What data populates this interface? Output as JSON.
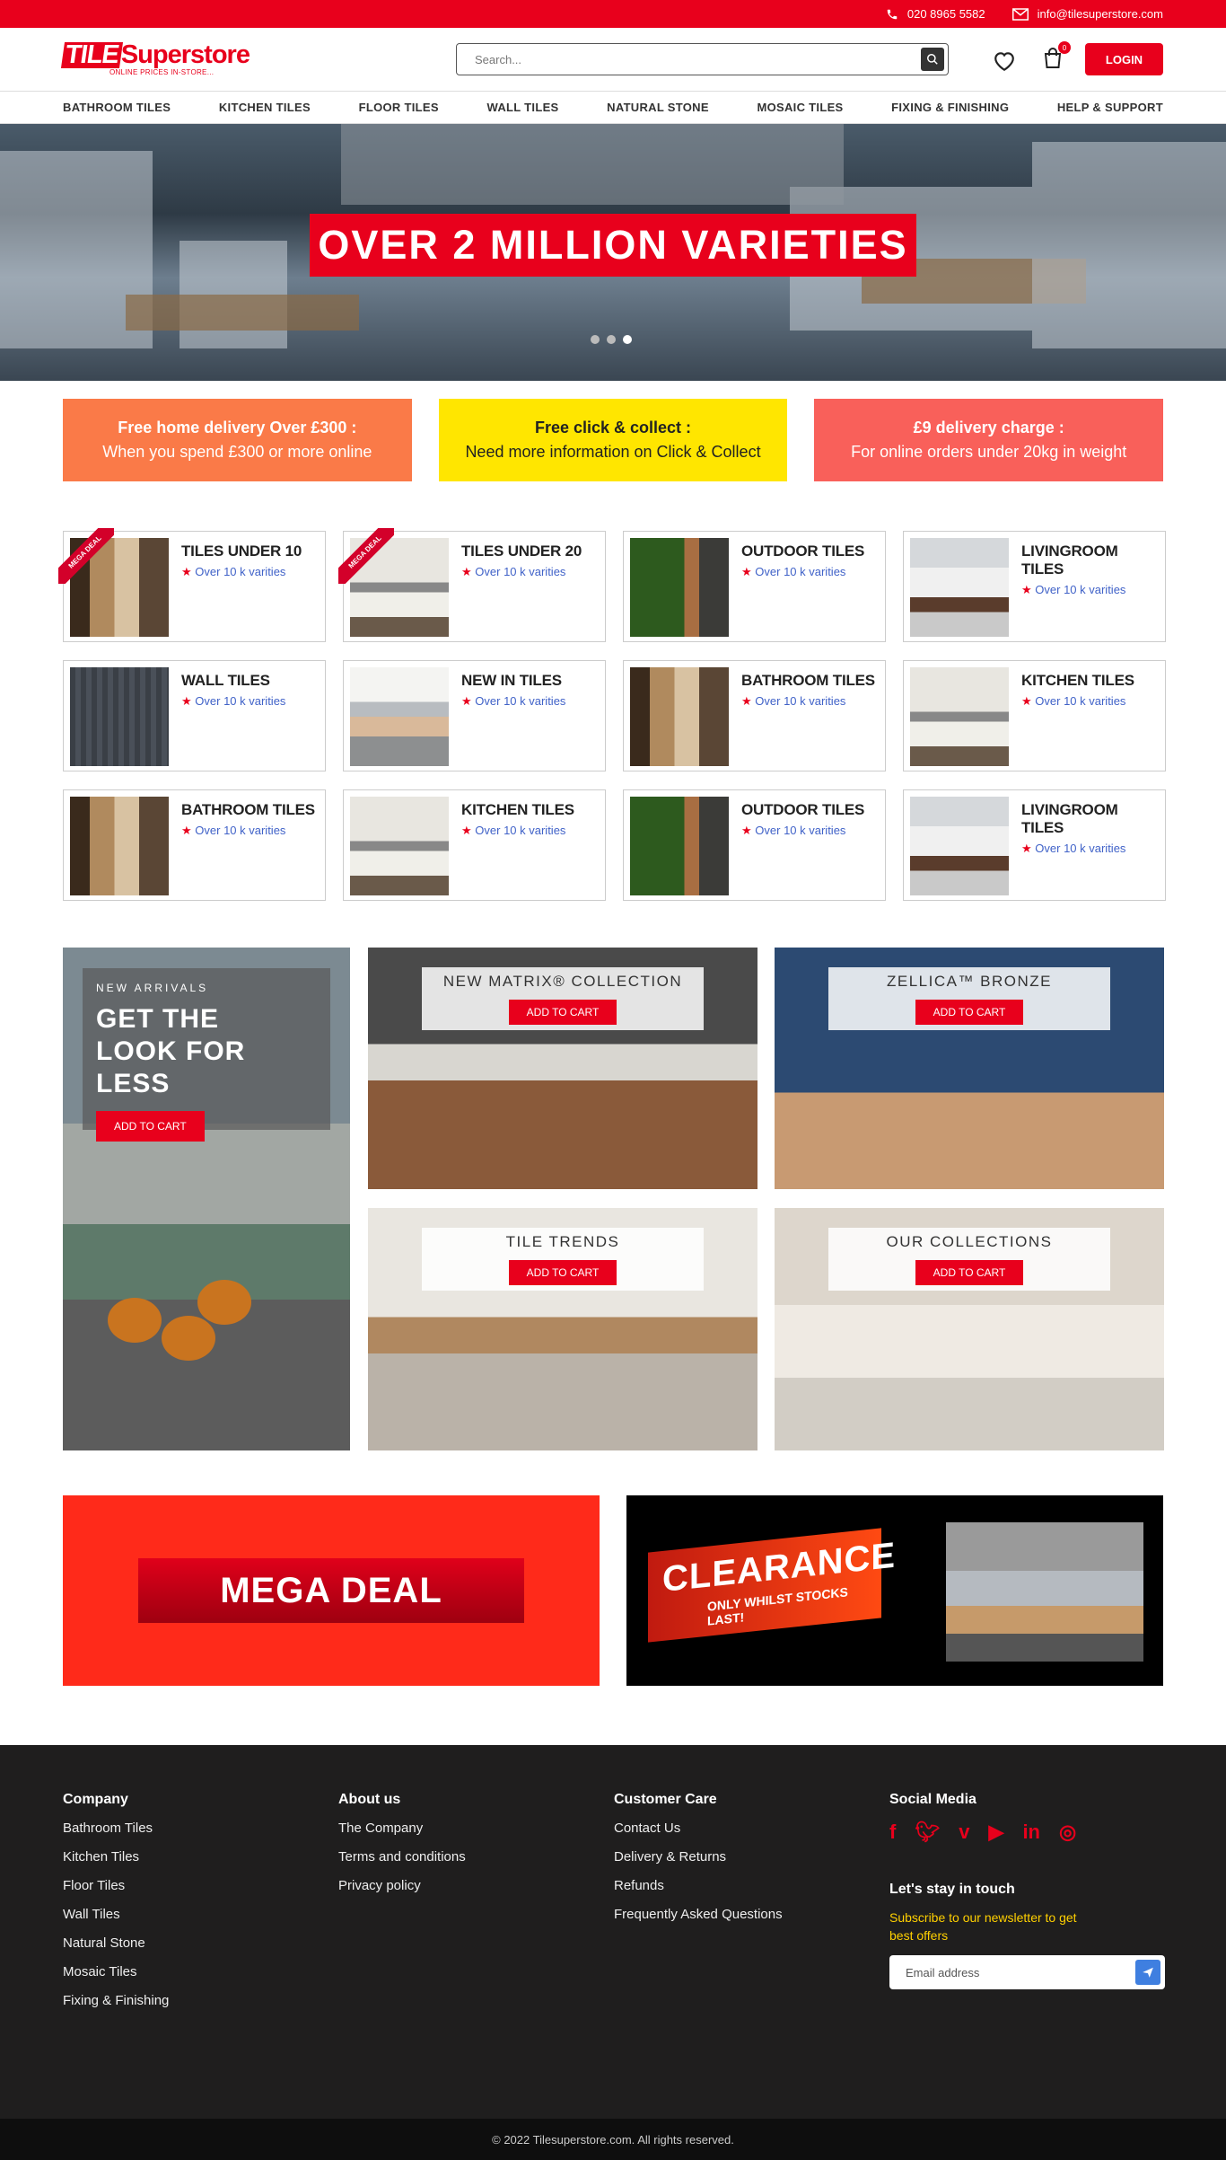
{
  "topbar": {
    "phone": "020 8965 5582",
    "email": "info@tilesuperstore.com"
  },
  "header": {
    "logo_tile": "TILE",
    "logo_superstore": "Superstore",
    "logo_tagline": "ONLINE PRICES IN-STORE...",
    "search_placeholder": "Search...",
    "cart_count": "0",
    "login_label": "LOGIN"
  },
  "nav": [
    "BATHROOM TILES",
    "KITCHEN TILES",
    "FLOOR TILES",
    "WALL TILES",
    "NATURAL STONE",
    "MOSAIC TILES",
    "FIXING & FINISHING",
    "HELP & SUPPORT"
  ],
  "hero": {
    "headline": "OVER 2 MILLION VARIETIES",
    "slides": 3,
    "active_slide": 3
  },
  "promos": [
    {
      "title": "Free home delivery Over £300 :",
      "text": "When you spend £300 or more online",
      "color": "#fa7a48"
    },
    {
      "title": "Free click & collect :",
      "text": "Need more information on Click & Collect",
      "color": "#ffe600"
    },
    {
      "title": "£9 delivery charge :",
      "text": "For online orders under 20kg in weight",
      "color": "#f9605a"
    }
  ],
  "categories": [
    {
      "title": "TILES UNDER 10",
      "sub": "Over 10 k varities",
      "ribbon": "MEGA DEAL"
    },
    {
      "title": "TILES UNDER 20",
      "sub": "Over 10 k varities",
      "ribbon": "MEGA DEAL"
    },
    {
      "title": "OUTDOOR TILES",
      "sub": "Over 10 k varities"
    },
    {
      "title": "LIVINGROOM TILES",
      "sub": "Over 10 k varities"
    },
    {
      "title": "WALL TILES",
      "sub": "Over 10 k varities"
    },
    {
      "title": "NEW IN TILES",
      "sub": "Over 10 k varities"
    },
    {
      "title": "BATHROOM TILES",
      "sub": "Over 10 k varities"
    },
    {
      "title": "KITCHEN TILES",
      "sub": "Over 10 k varities"
    },
    {
      "title": "BATHROOM TILES",
      "sub": "Over 10 k varities"
    },
    {
      "title": "KITCHEN TILES",
      "sub": "Over 10 k varities"
    },
    {
      "title": "OUTDOOR TILES",
      "sub": "Over 10 k varities"
    },
    {
      "title": "LIVINGROOM TILES",
      "sub": "Over 10 k varities"
    }
  ],
  "featured": {
    "left": {
      "kicker": "NEW ARRIVALS",
      "title": "GET THE\nLOOK FOR LESS",
      "button": "ADD TO CART"
    },
    "blocks": [
      {
        "title": "NEW MATRIX® COLLECTION",
        "button": "ADD TO CART"
      },
      {
        "title": "ZELLICA™ BRONZE",
        "button": "ADD TO CART"
      },
      {
        "title": "TILE TRENDS",
        "button": "ADD TO CART"
      },
      {
        "title": "OUR COLLECTIONS",
        "button": "ADD TO CART"
      }
    ]
  },
  "deals": {
    "mega": "MEGA DEAL",
    "clearance": "CLEARANCE",
    "clearance_sub": "ONLY WHILST STOCKS LAST!"
  },
  "footer": {
    "company": {
      "heading": "Company",
      "links": [
        "Bathroom Tiles",
        "Kitchen Tiles",
        "Floor Tiles",
        "Wall Tiles",
        "Natural Stone",
        "Mosaic Tiles",
        "Fixing & Finishing"
      ]
    },
    "about": {
      "heading": "About us",
      "links": [
        "The Company",
        "Terms and conditions",
        "Privacy policy"
      ]
    },
    "care": {
      "heading": "Customer Care",
      "links": [
        "Contact Us",
        "Delivery & Returns",
        "Refunds",
        "Frequently Asked Questions"
      ]
    },
    "social": {
      "heading": "Social Media",
      "icons": [
        "facebook-icon",
        "twitter-icon",
        "vimeo-icon",
        "youtube-icon",
        "linkedin-icon",
        "instagram-icon"
      ]
    },
    "stay_heading": "Let's stay in touch",
    "newsletter_text": "Subscribe to our newsletter to get best offers",
    "email_placeholder": "Email address"
  },
  "copyright": "© 2022 Tilesuperstore.com. All rights reserved."
}
